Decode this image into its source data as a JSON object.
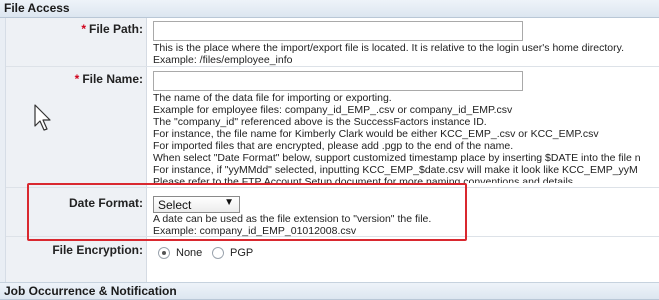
{
  "section_top": {
    "title": "File Access"
  },
  "section_bottom": {
    "title": "Job Occurrence & Notification"
  },
  "file_path": {
    "required_marker": "*",
    "label": "File Path:",
    "value": "",
    "help": [
      "This is the place where the import/export file is located. It is relative to the login user's home directory.",
      "Example: /files/employee_info"
    ]
  },
  "file_name": {
    "required_marker": "*",
    "label": "File Name:",
    "value": "",
    "help": [
      "The name of the data file for importing or exporting.",
      "Example for employee files: company_id_EMP_.csv or company_id_EMP.csv",
      "The \"company_id\" referenced above is the SuccessFactors instance ID.",
      "For instance, the file name for Kimberly Clark would be either KCC_EMP_.csv or KCC_EMP.csv",
      "For imported files that are encrypted, please add .pgp to the end of the name.",
      "When select \"Date Format\" below, support customized timestamp place by inserting $DATE into the file n",
      "For instance, if \"yyMMdd\" selected, inputting KCC_EMP_$date.csv will make it look like KCC_EMP_yyM",
      "Please refer to the FTP Account Setup document for more naming conventions and details."
    ]
  },
  "date_format": {
    "label": "Date Format:",
    "selected": "Select",
    "help": [
      "A date can be used as the file extension to \"version\" the file.",
      "Example: company_id_EMP_01012008.csv"
    ]
  },
  "file_encryption": {
    "label": "File Encryption:",
    "options": [
      "None",
      "PGP"
    ],
    "selected": "None"
  },
  "colors": {
    "highlight_box": "#d9282f",
    "required": "#d0021b"
  }
}
